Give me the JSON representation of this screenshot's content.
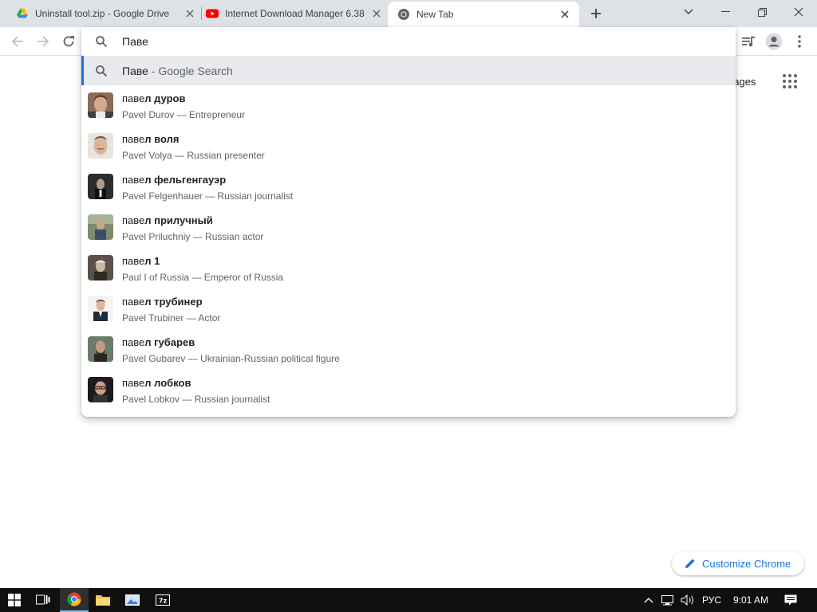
{
  "tabs": [
    {
      "title": "Uninstall tool.zip - Google Drive",
      "favicon": "google-drive-icon"
    },
    {
      "title": "Internet Download Manager 6.38",
      "favicon": "youtube-icon"
    },
    {
      "title": "New Tab",
      "favicon": "chrome-icon",
      "active": true
    }
  ],
  "omnibox": {
    "input_text": "Паве",
    "selected": {
      "query": "Паве",
      "separator": " - ",
      "engine": "Google Search"
    },
    "suggestions": [
      {
        "typed": "паве",
        "completion": "л дуров",
        "subtitle": "Pavel Durov — Entrepreneur"
      },
      {
        "typed": "паве",
        "completion": "л воля",
        "subtitle": "Pavel Volya — Russian presenter"
      },
      {
        "typed": "паве",
        "completion": "л фельгенгауэр",
        "subtitle": "Pavel Felgenhauer — Russian journalist"
      },
      {
        "typed": "паве",
        "completion": "л прилучный",
        "subtitle": "Pavel Priluchniy — Russian actor"
      },
      {
        "typed": "паве",
        "completion": "л 1",
        "subtitle": "Paul I of Russia — Emperor of Russia"
      },
      {
        "typed": "паве",
        "completion": "л трубинер",
        "subtitle": "Pavel Trubiner — Actor"
      },
      {
        "typed": "паве",
        "completion": "л губарев",
        "subtitle": "Pavel Gubarev — Ukrainian-Russian political figure"
      },
      {
        "typed": "паве",
        "completion": "л лобков",
        "subtitle": "Pavel Lobkov — Russian journalist"
      }
    ]
  },
  "page": {
    "images_link": "nages",
    "customize_label": "Customize Chrome"
  },
  "taskbar": {
    "language": "РУС",
    "time": "9:01 AM"
  },
  "colors": {
    "accent": "#1a73e8",
    "tabstrip": "#dee1e6",
    "selected_row": "#e8eaed"
  }
}
